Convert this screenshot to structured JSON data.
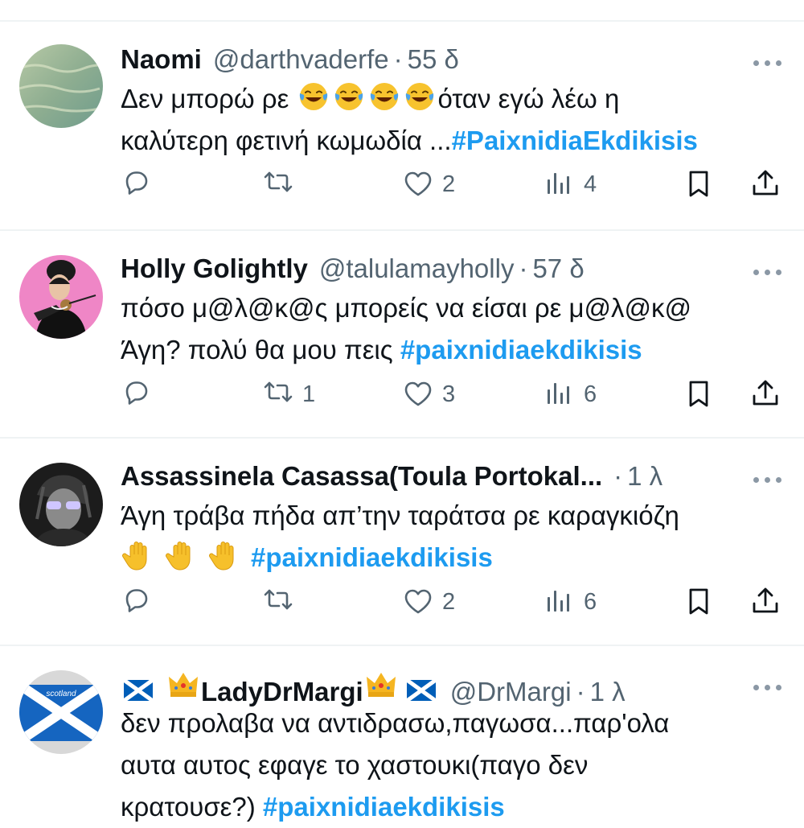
{
  "tweets": [
    {
      "name": "Naomi",
      "handle": "@darthvaderfe",
      "time": "55 δ",
      "text_lines": [
        "Δεν μπορώ ρε ",
        "όταν εγώ λέω η",
        "καλύτερη φετινή κωμωδία ..."
      ],
      "hashtag": "#PaixnidiaEkdikisis",
      "reply_count": "",
      "retweet_count": "",
      "like_count": "2",
      "view_count": "4"
    },
    {
      "name": "Holly Golightly",
      "handle": "@talulamayholly",
      "time": "57 δ",
      "text_lines": [
        "πόσο μ@λ@κ@ς μπορείς να είσαι ρε μ@λ@κ@",
        "Άγη? πολύ θα μου πεις "
      ],
      "hashtag": "#paixnidiaekdikisis",
      "reply_count": "",
      "retweet_count": "1",
      "like_count": "3",
      "view_count": "6"
    },
    {
      "name": "Assassinela Casassa(Toula Portokal...",
      "handle": "",
      "time": "1 λ",
      "text_lines": [
        "Άγη τράβα πήδα απ’την ταράτσα ρε καραγκιόζη"
      ],
      "hashtag": "#paixnidiaekdikisis",
      "reply_count": "",
      "retweet_count": "",
      "like_count": "2",
      "view_count": "6"
    },
    {
      "name": "LadyDrMargi",
      "handle": "@DrMargi",
      "time": "1 λ",
      "text_lines": [
        "δεν προλαβα να αντιδρασω,παγωσα...παρ'ολα",
        "αυτα αυτος εφαγε το χαστουκι(παγο δεν",
        "κρατουσε?) "
      ],
      "hashtag": "#paixnidiaekdikisis"
    }
  ],
  "avatar_badge_text": "scotland",
  "colors": {
    "hashtag": "#1d9bf0",
    "secondary": "#536471",
    "divider": "#eff3f4"
  },
  "icons": [
    "reply-icon",
    "retweet-icon",
    "like-icon",
    "views-icon",
    "bookmark-icon",
    "share-icon",
    "more-icon",
    "laughing-crying-emoji",
    "raised-hand-emoji",
    "scotland-flag-icon",
    "crown-emoji"
  ]
}
